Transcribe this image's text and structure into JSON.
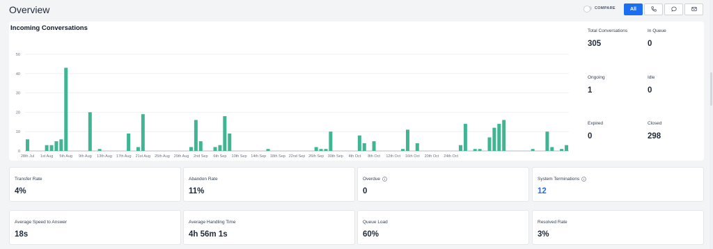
{
  "header": {
    "title": "Overview",
    "compare_label": "COMPARE",
    "channels": [
      {
        "label": "All",
        "icon": "",
        "active": true
      },
      {
        "label": "",
        "icon": "phone-icon",
        "active": false
      },
      {
        "label": "",
        "icon": "chat-bubble-icon",
        "active": false
      },
      {
        "label": "",
        "icon": "mail-icon",
        "active": false
      }
    ]
  },
  "chart": {
    "title": "Incoming Conversations"
  },
  "chart_data": {
    "type": "bar",
    "title": "Incoming Conversations",
    "xlabel": "",
    "ylabel": "",
    "ylim": [
      0,
      50
    ],
    "yticks": [
      0,
      10,
      20,
      30,
      40,
      50
    ],
    "grid": true,
    "color": "#3fb593",
    "x_tick_labels": [
      "28th Jul",
      "1st Aug",
      "5th Aug",
      "9th Aug",
      "13th Aug",
      "17th Aug",
      "21st Aug",
      "25th Aug",
      "29th Aug",
      "2nd Sep",
      "6th Sep",
      "10th Sep",
      "14th Sep",
      "18th Sep",
      "22nd Sep",
      "26th Sep",
      "30th Sep",
      "4th Oct",
      "8th Oct",
      "12th Oct",
      "16th Oct",
      "20th Oct",
      "24th Oct"
    ],
    "values": [
      6,
      0,
      0,
      0,
      3,
      3,
      5,
      6,
      43,
      0,
      0,
      0,
      0,
      20,
      0,
      1,
      0,
      0,
      0,
      0,
      0,
      9,
      0,
      2,
      19,
      0,
      0,
      0,
      0,
      0,
      0,
      0,
      0,
      0,
      2,
      16,
      5,
      0,
      0,
      2,
      3,
      18,
      9,
      0,
      0,
      0,
      0,
      0,
      0,
      0,
      1,
      0,
      0,
      0,
      0,
      0,
      0,
      0,
      0,
      0,
      2,
      1,
      1,
      10,
      0,
      0,
      0,
      0,
      0,
      8,
      4,
      0,
      5,
      0,
      0,
      0,
      0,
      0,
      1,
      11,
      0,
      4,
      0,
      0,
      0,
      0,
      0,
      0,
      0,
      0,
      3,
      14,
      0,
      1,
      1,
      0,
      7,
      12,
      14,
      16,
      0,
      0,
      0,
      0,
      0,
      1,
      0,
      0,
      10,
      2,
      0,
      1,
      3
    ]
  },
  "stats": [
    {
      "label": "Total Conversations",
      "value": "305"
    },
    {
      "label": "In Queue",
      "value": "0"
    },
    {
      "label": "Ongoing",
      "value": "1"
    },
    {
      "label": "Idle",
      "value": "0"
    },
    {
      "label": "Expired",
      "value": "0"
    },
    {
      "label": "Closed",
      "value": "298"
    }
  ],
  "metrics": [
    {
      "label": "Transfer Rate",
      "value": "4%",
      "info": false,
      "highlight": false
    },
    {
      "label": "Abandon Rate",
      "value": "11%",
      "info": false,
      "highlight": false
    },
    {
      "label": "Overdue",
      "value": "0",
      "info": true,
      "highlight": false
    },
    {
      "label": "System Terminations",
      "value": "12",
      "info": true,
      "highlight": true
    },
    {
      "label": "Average Speed to Answer",
      "value": "18s",
      "info": false,
      "highlight": false
    },
    {
      "label": "Average Handling Time",
      "value": "4h 56m 1s",
      "info": false,
      "highlight": false
    },
    {
      "label": "Queue Load",
      "value": "60%",
      "info": false,
      "highlight": false
    },
    {
      "label": "Resolved Rate",
      "value": "3%",
      "info": false,
      "highlight": false
    }
  ]
}
